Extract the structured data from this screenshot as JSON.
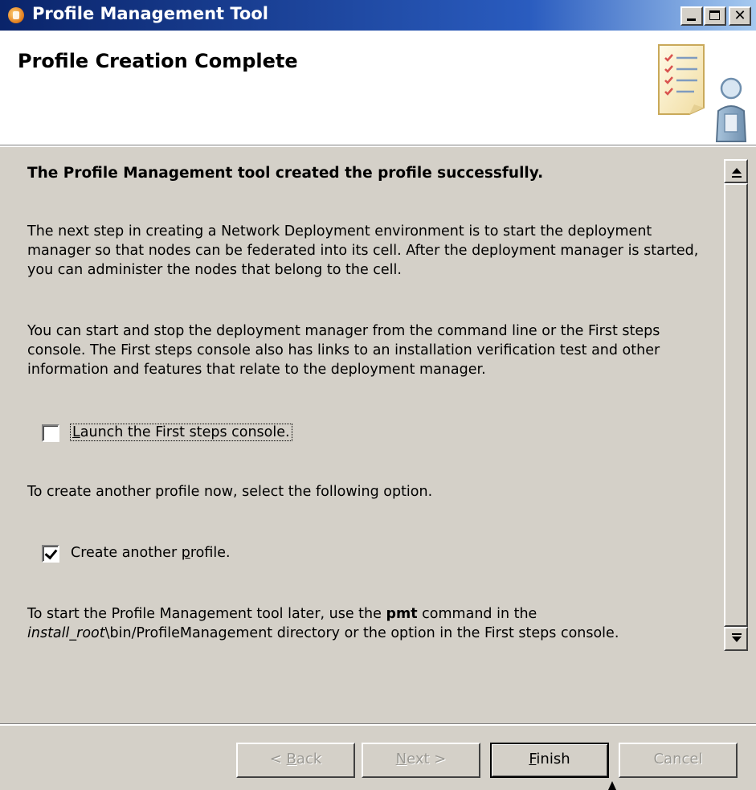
{
  "window": {
    "title": "Profile Management Tool",
    "close_glyph": "✕"
  },
  "header": {
    "title": "Profile Creation Complete",
    "graphic_icon": "checklist-person-icon"
  },
  "content": {
    "heading": "The Profile Management tool created the profile successfully.",
    "paragraph1": "The next step in creating a Network Deployment environment is to start the deployment manager so that nodes can be federated into its cell. After the deployment manager is started, you can administer the nodes that belong to the cell.",
    "paragraph2": "You can start and stop the deployment manager from the command line or the First steps console. The First steps console also has links to an installation verification test and other information and features that relate to the deployment manager.",
    "launch_checkbox": {
      "label_mnemonic": "L",
      "label_rest": "aunch the First steps console.",
      "checked": false
    },
    "paragraph3": "To create another profile now, select the following option.",
    "create_checkbox": {
      "label_before": "Create another ",
      "label_mnemonic": "p",
      "label_after": "rofile.",
      "checked": true
    },
    "paragraph4": {
      "text_before": "To start the Profile Management tool later, use the ",
      "command": "pmt",
      "text_mid": " command in the",
      "path_italic": "install_root",
      "path_rest": "\\bin/ProfileManagement directory or the option in the First steps console."
    }
  },
  "buttons": {
    "back": {
      "prefix": "< ",
      "mnemonic": "B",
      "rest": "ack"
    },
    "next": {
      "mnemonic": "N",
      "rest": "ext >"
    },
    "finish": {
      "mnemonic": "F",
      "rest": "inish"
    },
    "cancel": "Cancel"
  },
  "colors": {
    "titlebar_start": "#0a246a",
    "titlebar_end": "#a6caf0",
    "dialog_face": "#d4d0c8"
  }
}
